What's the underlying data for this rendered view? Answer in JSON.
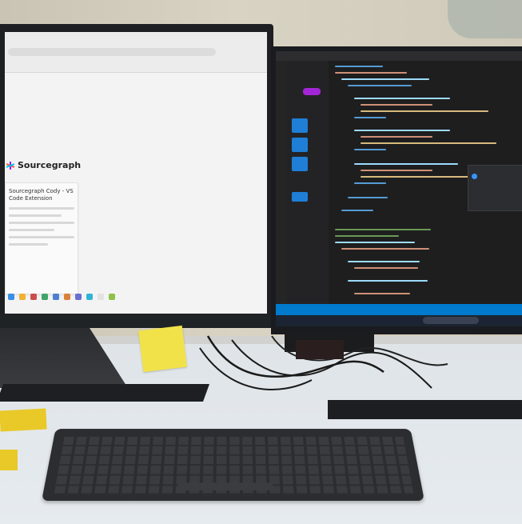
{
  "scene": {
    "description_type": "photo",
    "left_monitor": {
      "brand_text": "Sourcegraph",
      "card_title": "Sourcegraph Cody - VS Code Extension"
    },
    "right_monitor": {
      "editor": "VS Code"
    }
  },
  "colors": {
    "vscode_blue": "#007acc",
    "sticky_yellow": "#f1e24a",
    "sidebar_button": "#1f7fd6",
    "pill_purple": "#a425d8"
  }
}
